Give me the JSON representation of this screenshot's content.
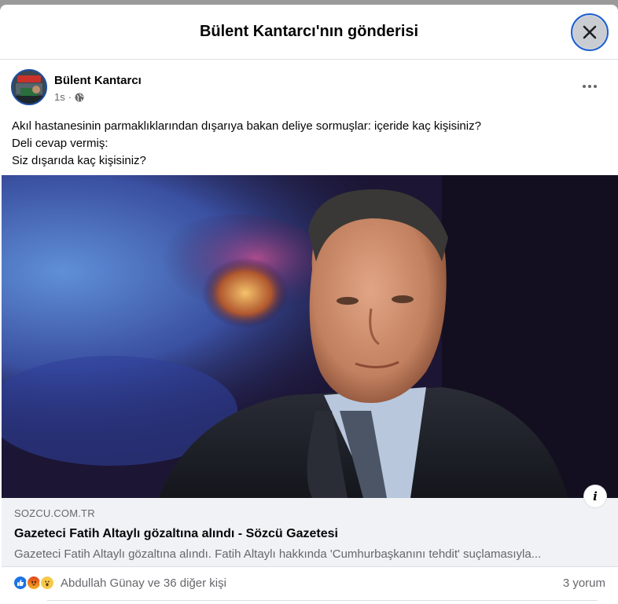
{
  "modal": {
    "title": "Bülent Kantarcı'nın gönderisi"
  },
  "post": {
    "author": "Bülent Kantarcı",
    "time": "1s",
    "privacy_icon": "globe-icon",
    "text_lines": [
      "Akıl hastanesinin parmaklıklarından dışarıya bakan deliye sormuşlar: içeride kaç kişisiniz?",
      "Deli cevap vermiş:",
      "Siz dışarıda kaç kişisiniz?"
    ]
  },
  "link": {
    "domain": "SOZCU.COM.TR",
    "title": "Gazeteci Fatih Altaylı gözaltına alındı - Sözcü Gazetesi",
    "description": "Gazeteci Fatih Altaylı gözaltına alındı. Fatih Altaylı hakkında 'Cumhurbaşkanını tehdit' suçlamasıyla..."
  },
  "reactions": {
    "names": "Abdullah Günay ve 36 diğer kişi",
    "comments": "3 yorum",
    "icons": [
      "like-icon",
      "angry-icon",
      "wow-icon"
    ]
  },
  "colors": {
    "accent": "#1b74e4",
    "focus_ring": "#1b5fd1",
    "secondary_text": "#65676b",
    "card_bg": "#f0f2f5"
  }
}
